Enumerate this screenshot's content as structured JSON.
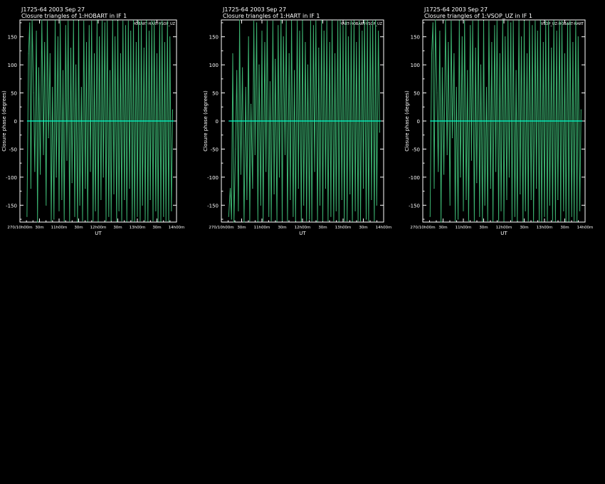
{
  "page": {
    "background": "#000000",
    "trace_color": "#3cb371",
    "zero_line_color": "#00ffcc"
  },
  "chart_data": [
    {
      "type": "line",
      "header_line1": "J1725-64  2003 Sep 27",
      "title": "Closure triangles of 1:HOBART in IF 1",
      "legend": "HOBART-HART-VSOP_UZ",
      "xlabel": "UT",
      "ylabel": "Closure phase  (degrees)",
      "x_tick_labels": [
        "270/10h00m",
        "30m",
        "11h00m",
        "30m",
        "12h00m",
        "30m",
        "13h00m",
        "30m",
        "14h00m"
      ],
      "y_ticks": [
        -150,
        -100,
        -50,
        0,
        50,
        100,
        150
      ],
      "ylim": [
        -180,
        180
      ],
      "xlim_hours": [
        10.0,
        14.0
      ],
      "zero_line": 0,
      "series": [
        {
          "x_hours": [
            10.18,
            10.22,
            10.25,
            10.28,
            10.31,
            10.35,
            10.38,
            10.42,
            10.45,
            10.48,
            10.52,
            10.56,
            10.6,
            10.63,
            10.67,
            10.7,
            10.73,
            10.77,
            10.8,
            10.83,
            10.87,
            10.9,
            10.93,
            10.97,
            11.0,
            11.03,
            11.07,
            11.1,
            11.13,
            11.17,
            11.2,
            11.23,
            11.27,
            11.3,
            11.33,
            11.37,
            11.4,
            11.43,
            11.47,
            11.5,
            11.53,
            11.57,
            11.6,
            11.63,
            11.67,
            11.7,
            11.73,
            11.77,
            11.8,
            11.83,
            11.87,
            11.9,
            11.93,
            11.97,
            12.0,
            12.03,
            12.07,
            12.1,
            12.13,
            12.17,
            12.2,
            12.23,
            12.27,
            12.3,
            12.33,
            12.37,
            12.4,
            12.43,
            12.47,
            12.5,
            12.53,
            12.57,
            12.6,
            12.63,
            12.67,
            12.7,
            12.73,
            12.77,
            12.8,
            12.83,
            12.87,
            12.9,
            12.93,
            12.97,
            13.0,
            13.03,
            13.07,
            13.1,
            13.13,
            13.17,
            13.2,
            13.23,
            13.27,
            13.3,
            13.33,
            13.37,
            13.4,
            13.43,
            13.47,
            13.5,
            13.53,
            13.57,
            13.6,
            13.63,
            13.67,
            13.7,
            13.73,
            13.77,
            13.8,
            13.83,
            13.87,
            13.9
          ],
          "y": [
            -170,
            120,
            175,
            -120,
            180,
            50,
            -90,
            160,
            -180,
            95,
            -95,
            180,
            -60,
            140,
            -150,
            178,
            -30,
            120,
            -178,
            60,
            -175,
            179,
            -100,
            150,
            -160,
            178,
            -140,
            90,
            -178,
            170,
            -70,
            178,
            -178,
            130,
            -110,
            179,
            -170,
            100,
            -179,
            178,
            -150,
            60,
            -178,
            178,
            -120,
            140,
            -179,
            170,
            -90,
            178,
            -178,
            120,
            -160,
            179,
            -179,
            150,
            -140,
            178,
            -100,
            175,
            -178,
            178,
            -170,
            90,
            -178,
            179,
            -130,
            150,
            -179,
            178,
            -160,
            120,
            -178,
            178,
            -140,
            170,
            -179,
            178,
            -120,
            160,
            -178,
            179,
            -179,
            140,
            -170,
            178,
            -178,
            178,
            -150,
            130,
            -178,
            179,
            -179,
            160,
            -140,
            178,
            -178,
            178,
            -160,
            120,
            -179,
            175,
            -179,
            178,
            -170,
            140,
            -178,
            178,
            -179,
            150,
            -160,
            20
          ]
        }
      ]
    },
    {
      "type": "line",
      "header_line1": "J1725-64  2003 Sep 27",
      "title": "Closure triangles of 1:HART in IF 1",
      "legend": "HART-HOBART-VSOP_UZ",
      "xlabel": "UT",
      "ylabel": "Closure phase  (degrees)",
      "x_tick_labels": [
        "270/10h00m",
        "30m",
        "11h00m",
        "30m",
        "12h00m",
        "30m",
        "13h00m",
        "30m",
        "14h00m"
      ],
      "y_ticks": [
        -150,
        -100,
        -50,
        0,
        50,
        100,
        150
      ],
      "ylim": [
        -180,
        180
      ],
      "xlim_hours": [
        10.0,
        14.0
      ],
      "zero_line": 0,
      "series": [
        {
          "x_hours": [
            10.18,
            10.22,
            10.25,
            10.28,
            10.31,
            10.35,
            10.38,
            10.42,
            10.45,
            10.48,
            10.52,
            10.56,
            10.6,
            10.63,
            10.67,
            10.7,
            10.73,
            10.77,
            10.8,
            10.83,
            10.87,
            10.9,
            10.93,
            10.97,
            11.0,
            11.03,
            11.07,
            11.1,
            11.13,
            11.17,
            11.2,
            11.23,
            11.27,
            11.3,
            11.33,
            11.37,
            11.4,
            11.43,
            11.47,
            11.5,
            11.53,
            11.57,
            11.6,
            11.63,
            11.67,
            11.7,
            11.73,
            11.77,
            11.8,
            11.83,
            11.87,
            11.9,
            11.93,
            11.97,
            12.0,
            12.03,
            12.07,
            12.1,
            12.13,
            12.17,
            12.2,
            12.23,
            12.27,
            12.3,
            12.33,
            12.37,
            12.4,
            12.43,
            12.47,
            12.5,
            12.53,
            12.57,
            12.6,
            12.63,
            12.67,
            12.7,
            12.73,
            12.77,
            12.8,
            12.83,
            12.87,
            12.9,
            12.93,
            12.97,
            13.0,
            13.03,
            13.07,
            13.1,
            13.13,
            13.17,
            13.2,
            13.23,
            13.27,
            13.3,
            13.33,
            13.37,
            13.4,
            13.43,
            13.47,
            13.5,
            13.53,
            13.57,
            13.6,
            13.63,
            13.67,
            13.7,
            13.73,
            13.77,
            13.8,
            13.83,
            13.87,
            13.9
          ],
          "y": [
            -170,
            -120,
            -175,
            120,
            -180,
            -50,
            90,
            -160,
            180,
            -95,
            95,
            -180,
            60,
            -140,
            150,
            -178,
            30,
            -120,
            178,
            -60,
            175,
            -179,
            100,
            -150,
            160,
            -178,
            140,
            -90,
            178,
            -170,
            70,
            -178,
            178,
            -130,
            110,
            -179,
            170,
            -100,
            179,
            -178,
            150,
            -60,
            178,
            -178,
            120,
            -140,
            179,
            -170,
            90,
            -178,
            178,
            -120,
            160,
            -179,
            179,
            -150,
            140,
            -178,
            100,
            -175,
            178,
            -178,
            170,
            -90,
            178,
            -179,
            130,
            -150,
            179,
            -178,
            160,
            -120,
            178,
            -178,
            140,
            -170,
            179,
            -178,
            120,
            -160,
            178,
            -179,
            179,
            -140,
            170,
            -178,
            178,
            -178,
            150,
            -130,
            178,
            -179,
            179,
            -160,
            140,
            -178,
            178,
            -178,
            160,
            -120,
            179,
            -175,
            179,
            -178,
            170,
            -140,
            178,
            -178,
            179,
            -150,
            160,
            -20
          ]
        }
      ]
    },
    {
      "type": "line",
      "header_line1": "J1725-64  2003 Sep 27",
      "title": "Closure triangles of 1:VSOP_UZ in IF 1",
      "legend": "VSOP_UZ-HOBART-HART",
      "xlabel": "UT",
      "ylabel": "Closure phase  (degrees)",
      "x_tick_labels": [
        "270/10h00m",
        "30m",
        "11h00m",
        "30m",
        "12h00m",
        "30m",
        "13h00m",
        "30m",
        "14h00m"
      ],
      "y_ticks": [
        -150,
        -100,
        -50,
        0,
        50,
        100,
        150
      ],
      "ylim": [
        -180,
        180
      ],
      "xlim_hours": [
        10.0,
        14.0
      ],
      "zero_line": 0,
      "series": [
        {
          "x_hours": [
            10.18,
            10.22,
            10.25,
            10.28,
            10.31,
            10.35,
            10.38,
            10.42,
            10.45,
            10.48,
            10.52,
            10.56,
            10.6,
            10.63,
            10.67,
            10.7,
            10.73,
            10.77,
            10.8,
            10.83,
            10.87,
            10.9,
            10.93,
            10.97,
            11.0,
            11.03,
            11.07,
            11.1,
            11.13,
            11.17,
            11.2,
            11.23,
            11.27,
            11.3,
            11.33,
            11.37,
            11.4,
            11.43,
            11.47,
            11.5,
            11.53,
            11.57,
            11.6,
            11.63,
            11.67,
            11.7,
            11.73,
            11.77,
            11.8,
            11.83,
            11.87,
            11.9,
            11.93,
            11.97,
            12.0,
            12.03,
            12.07,
            12.1,
            12.13,
            12.17,
            12.2,
            12.23,
            12.27,
            12.3,
            12.33,
            12.37,
            12.4,
            12.43,
            12.47,
            12.5,
            12.53,
            12.57,
            12.6,
            12.63,
            12.67,
            12.7,
            12.73,
            12.77,
            12.8,
            12.83,
            12.87,
            12.9,
            12.93,
            12.97,
            13.0,
            13.03,
            13.07,
            13.1,
            13.13,
            13.17,
            13.2,
            13.23,
            13.27,
            13.3,
            13.33,
            13.37,
            13.4,
            13.43,
            13.47,
            13.5,
            13.53,
            13.57,
            13.6,
            13.63,
            13.67,
            13.7,
            13.73,
            13.77,
            13.8,
            13.83,
            13.87,
            13.9
          ],
          "y": [
            -170,
            120,
            175,
            -120,
            180,
            50,
            -90,
            160,
            -180,
            95,
            -95,
            180,
            -60,
            140,
            -150,
            178,
            -30,
            120,
            -178,
            60,
            -175,
            179,
            -100,
            150,
            -160,
            178,
            -140,
            90,
            -178,
            170,
            -70,
            178,
            -178,
            130,
            -110,
            179,
            -170,
            100,
            -179,
            178,
            -150,
            60,
            -178,
            178,
            -120,
            140,
            -179,
            170,
            -90,
            178,
            -178,
            120,
            -160,
            179,
            -179,
            150,
            -140,
            178,
            -100,
            175,
            -178,
            178,
            -170,
            90,
            -178,
            179,
            -130,
            150,
            -179,
            178,
            -160,
            120,
            -178,
            178,
            -140,
            170,
            -179,
            178,
            -120,
            160,
            -178,
            179,
            -179,
            140,
            -170,
            178,
            -178,
            178,
            -150,
            130,
            -178,
            179,
            -179,
            160,
            -140,
            178,
            -178,
            178,
            -160,
            120,
            -179,
            175,
            -179,
            178,
            -170,
            140,
            -178,
            178,
            -179,
            150,
            -160,
            20
          ]
        }
      ]
    }
  ]
}
